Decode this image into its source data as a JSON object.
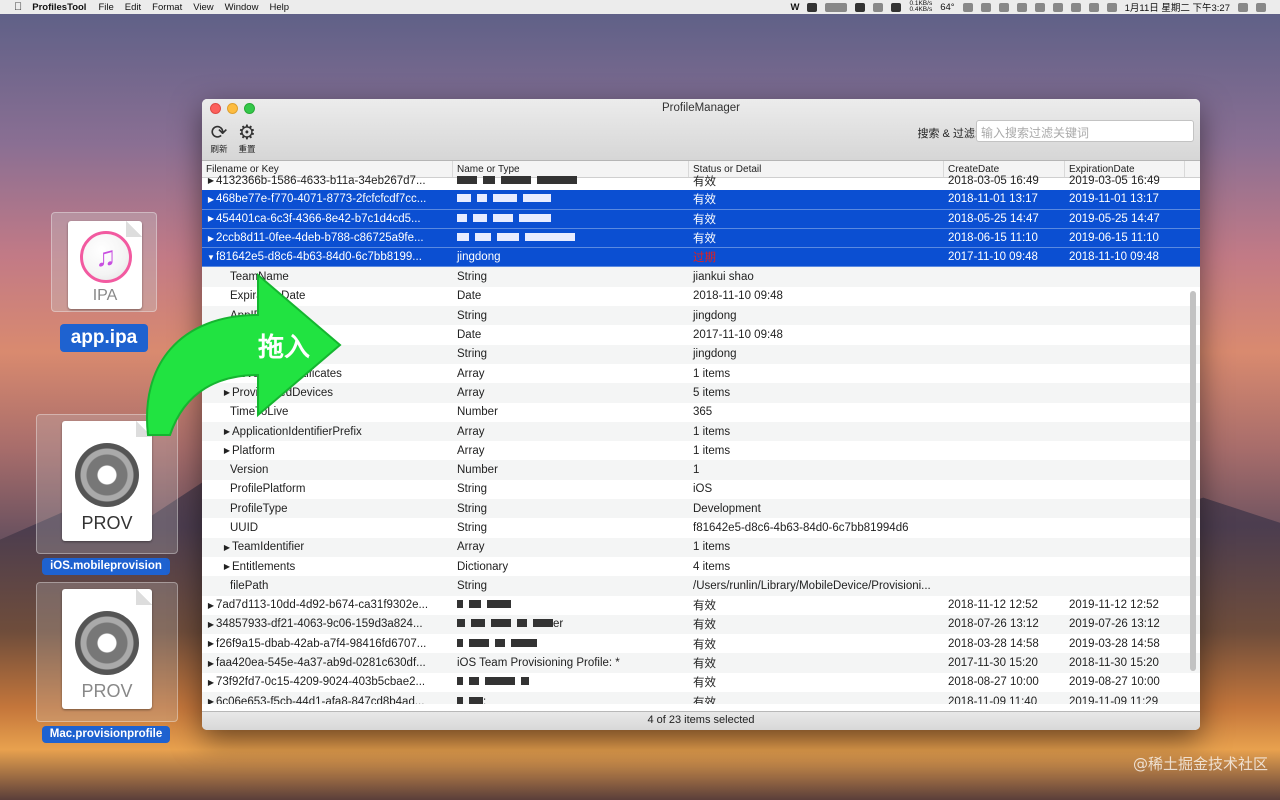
{
  "menubar": {
    "app_name": "ProfilesTool",
    "items": [
      "File",
      "Edit",
      "Format",
      "View",
      "Window",
      "Help"
    ],
    "net_up": "0.1KB/s",
    "net_down": "0.4KB/s",
    "temp": "64°",
    "clock": "1月11日 星期二 下午3:27"
  },
  "desktop": {
    "ipa_label": "IPA",
    "ipa_name": "app.ipa",
    "prov_label": "PROV",
    "ios_name": "iOS.mobileprovision",
    "mac_name": "Mac.provisionprofile",
    "arrow_text": "拖入"
  },
  "window": {
    "title": "ProfileManager",
    "refresh_label": "刷新",
    "reset_label": "重置",
    "search_label": "搜索 & 过滤:",
    "search_placeholder": "输入搜索过滤关键词",
    "columns": [
      "Filename or Key",
      "Name or Type",
      "Status or Detail",
      "CreateDate",
      "ExpirationDate"
    ],
    "status": "4 of 23 items selected"
  },
  "rows": [
    {
      "k": "4132366b-1586-4633-b11a-34eb267d7...",
      "t": "",
      "d": "有效",
      "c": "2018-03-05 16:49",
      "e": "2019-03-05 16:49"
    },
    {
      "k": "468be77e-f770-4071-8773-2fcfcfcdf7cc...",
      "t": "",
      "d": "有效",
      "c": "2018-11-01 13:17",
      "e": "2019-11-01 13:17"
    },
    {
      "k": "454401ca-6c3f-4366-8e42-b7c1d4cd5...",
      "t": "",
      "d": "有效",
      "c": "2018-05-25 14:47",
      "e": "2019-05-25 14:47"
    },
    {
      "k": "2ccb8d11-0fee-4deb-b788-c86725a9fe...",
      "t": "",
      "d": "有效",
      "c": "2018-06-15 11:10",
      "e": "2019-06-15 11:10"
    },
    {
      "k": "f81642e5-d8c6-4b63-84d0-6c7bb8199...",
      "t": "jingdong",
      "d": "过期",
      "c": "2017-11-10 09:48",
      "e": "2018-11-10 09:48"
    },
    {
      "k": "TeamName",
      "t": "String",
      "d": "jiankui shao"
    },
    {
      "k": "ExpirationDate",
      "t": "Date",
      "d": "2018-11-10 09:48"
    },
    {
      "k": "AppIDName",
      "t": "String",
      "d": "jingdong"
    },
    {
      "k": "CreationDate",
      "t": "Date",
      "d": "2017-11-10 09:48"
    },
    {
      "k": "Name",
      "t": "String",
      "d": "jingdong"
    },
    {
      "k": "DeveloperCertificates",
      "t": "Array",
      "d": "1 items"
    },
    {
      "k": "ProvisionedDevices",
      "t": "Array",
      "d": "5 items"
    },
    {
      "k": "TimeToLive",
      "t": "Number",
      "d": "365"
    },
    {
      "k": "ApplicationIdentifierPrefix",
      "t": "Array",
      "d": "1 items"
    },
    {
      "k": "Platform",
      "t": "Array",
      "d": "1 items"
    },
    {
      "k": "Version",
      "t": "Number",
      "d": "1"
    },
    {
      "k": "ProfilePlatform",
      "t": "String",
      "d": "iOS"
    },
    {
      "k": "ProfileType",
      "t": "String",
      "d": "Development"
    },
    {
      "k": "UUID",
      "t": "String",
      "d": "f81642e5-d8c6-4b63-84d0-6c7bb81994d6"
    },
    {
      "k": "TeamIdentifier",
      "t": "Array",
      "d": "1 items"
    },
    {
      "k": "Entitlements",
      "t": "Dictionary",
      "d": "4 items"
    },
    {
      "k": "filePath",
      "t": "String",
      "d": "/Users/runlin/Library/MobileDevice/Provisioni..."
    },
    {
      "k": "7ad7d113-10dd-4d92-b674-ca31f9302e...",
      "t": "",
      "d": "有效",
      "c": "2018-11-12 12:52",
      "e": "2019-11-12 12:52"
    },
    {
      "k": "34857933-df21-4063-9c06-159d3a824...",
      "t": "er",
      "d": "有效",
      "c": "2018-07-26 13:12",
      "e": "2019-07-26 13:12"
    },
    {
      "k": "f26f9a15-dbab-42ab-a7f4-98416fd6707...",
      "t": "",
      "d": "有效",
      "c": "2018-03-28 14:58",
      "e": "2019-03-28 14:58"
    },
    {
      "k": "faa420ea-545e-4a37-ab9d-0281c630df...",
      "t": "iOS Team Provisioning Profile: *",
      "d": "有效",
      "c": "2017-11-30 15:20",
      "e": "2018-11-30 15:20"
    },
    {
      "k": "73f92fd7-0c15-4209-9024-403b5cbae2...",
      "t": "",
      "d": "有效",
      "c": "2018-08-27 10:00",
      "e": "2019-08-27 10:00"
    },
    {
      "k": "6c06e653-f5cb-44d1-afa8-847cd8b4ad...",
      "t": ":",
      "d": "有效",
      "c": "2018-11-09 11:40",
      "e": "2019-11-09 11:29"
    }
  ],
  "watermark": "@稀土掘金技术社区"
}
